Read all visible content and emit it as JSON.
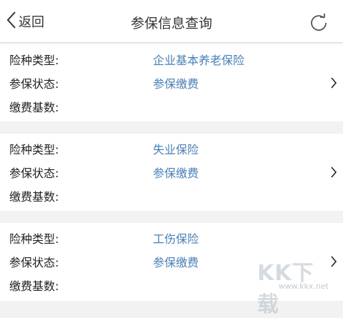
{
  "navbar": {
    "back_label": "返回",
    "title": "参保信息查询",
    "refresh_icon": "refresh-icon"
  },
  "cards": [
    {
      "rows": [
        {
          "label": "险种类型:",
          "value": "企业基本养老保险"
        },
        {
          "label": "参保状态:",
          "value": "参保缴费"
        },
        {
          "label": "缴费基数:",
          "value": ""
        }
      ]
    },
    {
      "rows": [
        {
          "label": "险种类型:",
          "value": "失业保险"
        },
        {
          "label": "参保状态:",
          "value": "参保缴费"
        },
        {
          "label": "缴费基数:",
          "value": ""
        }
      ]
    },
    {
      "rows": [
        {
          "label": "险种类型:",
          "value": "工伤保险"
        },
        {
          "label": "参保状态:",
          "value": "参保缴费"
        },
        {
          "label": "缴费基数:",
          "value": ""
        }
      ]
    }
  ],
  "watermark": {
    "logo": "KK下载",
    "url": "www.kkx.net"
  },
  "colors": {
    "value_text": "#4a7fb5",
    "background": "#f2f2f2",
    "card": "#ffffff"
  }
}
